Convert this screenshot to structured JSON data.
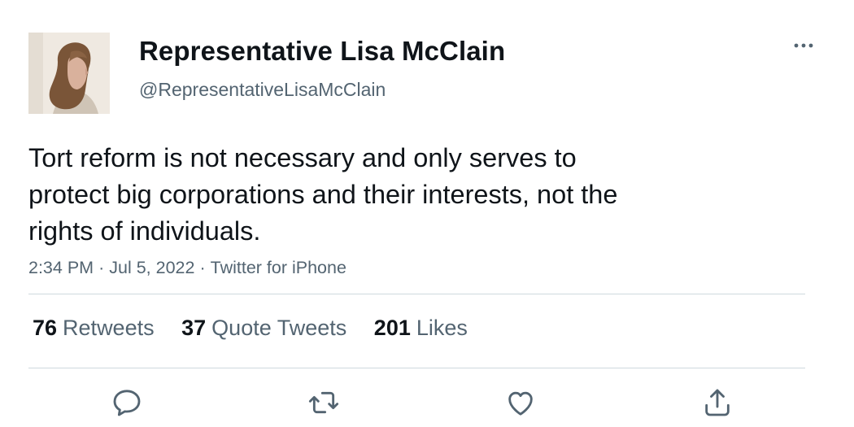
{
  "author": {
    "display_name": "Representative Lisa McClain",
    "handle": "@RepresentativeLisaMcClain"
  },
  "tweet": {
    "text_lines": [
      "Tort reform is not necessary and only serves to",
      "protect big corporations and their interests, not the",
      "rights of individuals."
    ],
    "time": "2:34 PM",
    "date": "Jul 5, 2022",
    "source": "Twitter for iPhone",
    "separator": "·"
  },
  "stats": {
    "retweets": {
      "count": "76",
      "label": "Retweets"
    },
    "quotes": {
      "count": "37",
      "label": "Quote Tweets"
    },
    "likes": {
      "count": "201",
      "label": "Likes"
    }
  },
  "icons": {
    "more": "more-horizontal-icon",
    "reply": "reply-icon",
    "retweet": "retweet-icon",
    "like": "heart-icon",
    "share": "share-icon"
  },
  "colors": {
    "text_primary": "#0f1419",
    "text_secondary": "#536471",
    "divider": "#cfd9de"
  }
}
